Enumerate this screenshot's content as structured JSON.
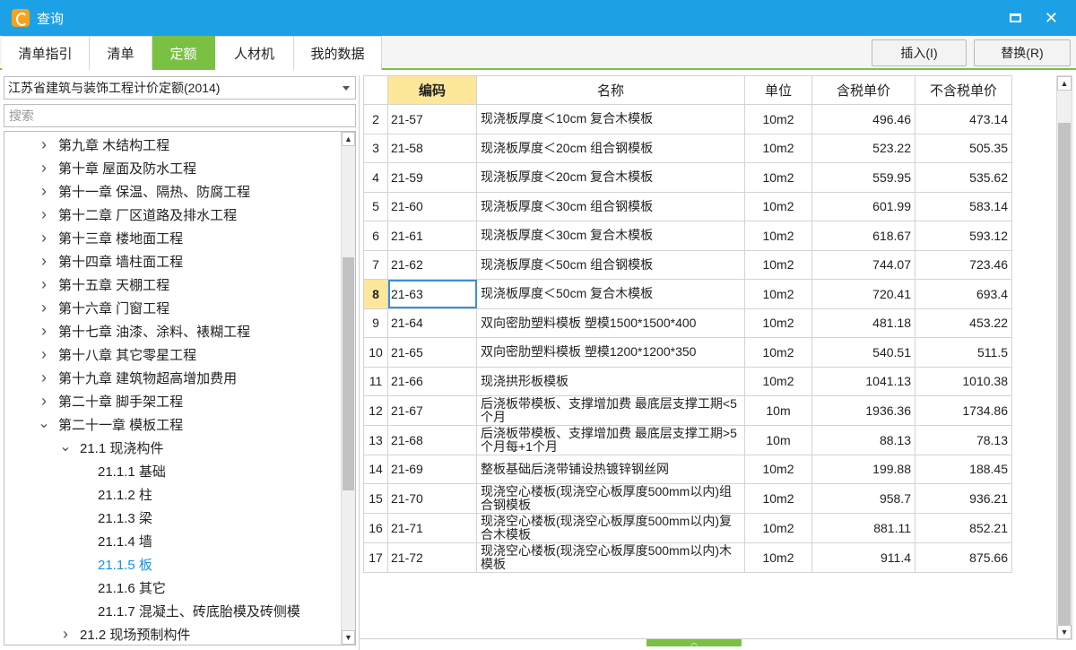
{
  "window": {
    "title": "查询"
  },
  "tabs": [
    {
      "label": "清单指引"
    },
    {
      "label": "清单"
    },
    {
      "label": "定额",
      "active": true
    },
    {
      "label": "人材机"
    },
    {
      "label": "我的数据"
    }
  ],
  "toolbar": {
    "insert_label": "插入(I)",
    "replace_label": "替换(R)"
  },
  "left": {
    "quota_library": "江苏省建筑与装饰工程计价定额(2014)",
    "search_placeholder": "搜索",
    "tree": [
      {
        "label": "第九章 木结构工程",
        "level": 0,
        "state": "collapsed"
      },
      {
        "label": "第十章 屋面及防水工程",
        "level": 0,
        "state": "collapsed"
      },
      {
        "label": "第十一章 保温、隔热、防腐工程",
        "level": 0,
        "state": "collapsed"
      },
      {
        "label": "第十二章 厂区道路及排水工程",
        "level": 0,
        "state": "collapsed"
      },
      {
        "label": "第十三章 楼地面工程",
        "level": 0,
        "state": "collapsed"
      },
      {
        "label": "第十四章 墙柱面工程",
        "level": 0,
        "state": "collapsed"
      },
      {
        "label": "第十五章 天棚工程",
        "level": 0,
        "state": "collapsed"
      },
      {
        "label": "第十六章 门窗工程",
        "level": 0,
        "state": "collapsed"
      },
      {
        "label": "第十七章 油漆、涂料、裱糊工程",
        "level": 0,
        "state": "collapsed"
      },
      {
        "label": "第十八章 其它零星工程",
        "level": 0,
        "state": "collapsed"
      },
      {
        "label": "第十九章 建筑物超高增加费用",
        "level": 0,
        "state": "collapsed"
      },
      {
        "label": "第二十章 脚手架工程",
        "level": 0,
        "state": "collapsed"
      },
      {
        "label": "第二十一章 模板工程",
        "level": 0,
        "state": "expanded"
      },
      {
        "label": "21.1 现浇构件",
        "level": 1,
        "state": "expanded"
      },
      {
        "label": "21.1.1 基础",
        "level": 2,
        "state": "leaf"
      },
      {
        "label": "21.1.2 柱",
        "level": 2,
        "state": "leaf"
      },
      {
        "label": "21.1.3 梁",
        "level": 2,
        "state": "leaf"
      },
      {
        "label": "21.1.4 墙",
        "level": 2,
        "state": "leaf"
      },
      {
        "label": "21.1.5 板",
        "level": 2,
        "state": "leaf",
        "selected": true
      },
      {
        "label": "21.1.6 其它",
        "level": 2,
        "state": "leaf"
      },
      {
        "label": "21.1.7 混凝土、砖底胎模及砖侧模",
        "level": 2,
        "state": "leaf"
      },
      {
        "label": "21.2 现场预制构件",
        "level": 1,
        "state": "collapsed"
      }
    ]
  },
  "grid": {
    "headers": {
      "code": "编码",
      "name": "名称",
      "unit": "单位",
      "price_tax": "含税单价",
      "price_notax": "不含税单价"
    },
    "current_row": "8",
    "rows": [
      {
        "idx": "2",
        "code": "21-57",
        "name": "现浇板厚度＜10cm 复合木模板",
        "unit": "10m2",
        "price_tax": "496.46",
        "price_notax": "473.14"
      },
      {
        "idx": "3",
        "code": "21-58",
        "name": "现浇板厚度＜20cm 组合钢模板",
        "unit": "10m2",
        "price_tax": "523.22",
        "price_notax": "505.35"
      },
      {
        "idx": "4",
        "code": "21-59",
        "name": "现浇板厚度＜20cm 复合木模板",
        "unit": "10m2",
        "price_tax": "559.95",
        "price_notax": "535.62"
      },
      {
        "idx": "5",
        "code": "21-60",
        "name": "现浇板厚度＜30cm 组合钢模板",
        "unit": "10m2",
        "price_tax": "601.99",
        "price_notax": "583.14"
      },
      {
        "idx": "6",
        "code": "21-61",
        "name": "现浇板厚度＜30cm 复合木模板",
        "unit": "10m2",
        "price_tax": "618.67",
        "price_notax": "593.12"
      },
      {
        "idx": "7",
        "code": "21-62",
        "name": "现浇板厚度＜50cm 组合钢模板",
        "unit": "10m2",
        "price_tax": "744.07",
        "price_notax": "723.46"
      },
      {
        "idx": "8",
        "code": "21-63",
        "name": "现浇板厚度＜50cm 复合木模板",
        "unit": "10m2",
        "price_tax": "720.41",
        "price_notax": "693.4"
      },
      {
        "idx": "9",
        "code": "21-64",
        "name": "双向密肋塑料模板 塑模1500*1500*400",
        "unit": "10m2",
        "price_tax": "481.18",
        "price_notax": "453.22"
      },
      {
        "idx": "10",
        "code": "21-65",
        "name": "双向密肋塑料模板 塑模1200*1200*350",
        "unit": "10m2",
        "price_tax": "540.51",
        "price_notax": "511.5"
      },
      {
        "idx": "11",
        "code": "21-66",
        "name": "现浇拱形板模板",
        "unit": "10m2",
        "price_tax": "1041.13",
        "price_notax": "1010.38"
      },
      {
        "idx": "12",
        "code": "21-67",
        "name": "后浇板带模板、支撑增加费 最底层支撑工期<5个月",
        "unit": "10m",
        "price_tax": "1936.36",
        "price_notax": "1734.86"
      },
      {
        "idx": "13",
        "code": "21-68",
        "name": "后浇板带模板、支撑增加费 最底层支撑工期>5个月每+1个月",
        "unit": "10m",
        "price_tax": "88.13",
        "price_notax": "78.13"
      },
      {
        "idx": "14",
        "code": "21-69",
        "name": "整板基础后浇带铺设热镀锌钢丝网",
        "unit": "10m2",
        "price_tax": "199.88",
        "price_notax": "188.45"
      },
      {
        "idx": "15",
        "code": "21-70",
        "name": "现浇空心楼板(现浇空心板厚度500mm以内)组合钢模板",
        "unit": "10m2",
        "price_tax": "958.7",
        "price_notax": "936.21"
      },
      {
        "idx": "16",
        "code": "21-71",
        "name": "现浇空心楼板(现浇空心板厚度500mm以内)复合木模板",
        "unit": "10m2",
        "price_tax": "881.11",
        "price_notax": "852.21"
      },
      {
        "idx": "17",
        "code": "21-72",
        "name": "现浇空心楼板(现浇空心板厚度500mm以内)木模板",
        "unit": "10m2",
        "price_tax": "911.4",
        "price_notax": "875.66"
      }
    ]
  },
  "colors": {
    "titlebar": "#1da1e6",
    "accent": "#7ac143",
    "highlight": "#fde79a",
    "selected_text": "#1a8fe0"
  }
}
